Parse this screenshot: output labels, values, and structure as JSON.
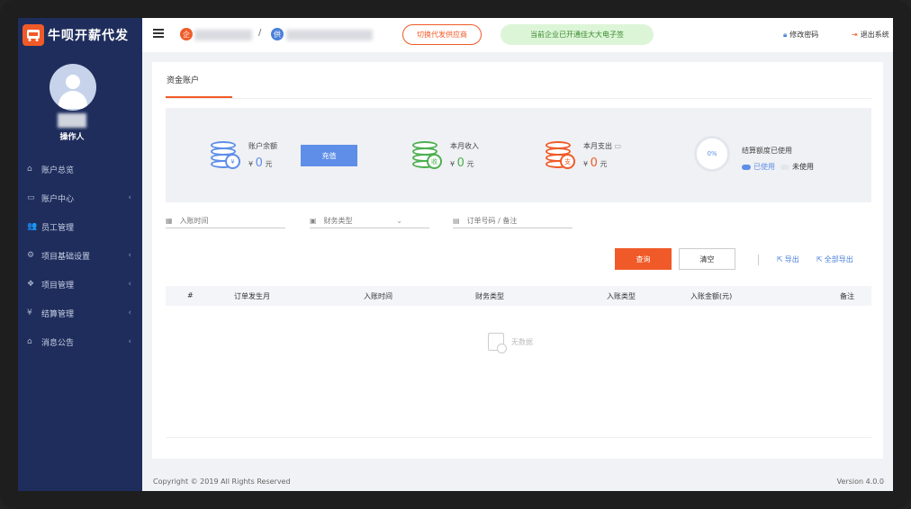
{
  "app": {
    "title": "牛呗开薪代发"
  },
  "sidebar": {
    "role": "操作人",
    "items": [
      {
        "label": "账户总览",
        "icon": "home-icon",
        "has_sub": false
      },
      {
        "label": "账户中心",
        "icon": "card-icon",
        "has_sub": true
      },
      {
        "label": "员工管理",
        "icon": "users-icon",
        "has_sub": false
      },
      {
        "label": "项目基础设置",
        "icon": "gear-icon",
        "has_sub": true
      },
      {
        "label": "项目管理",
        "icon": "cubes-icon",
        "has_sub": true
      },
      {
        "label": "结算管理",
        "icon": "yen-icon",
        "has_sub": true
      },
      {
        "label": "消息公告",
        "icon": "house-icon",
        "has_sub": true
      }
    ]
  },
  "topbar": {
    "switch_label": "切换代发供应商",
    "notice": "当前企业已开通佳大大电子签",
    "change_password": "修改密码",
    "logout": "退出系统",
    "breadcrumb_sep": "/"
  },
  "page": {
    "tab": "资金账户",
    "stats": {
      "balance_label": "账户余额",
      "balance_value": "0",
      "currency_prefix": "¥",
      "unit": "元",
      "recharge": "充值",
      "income_label": "本月收入",
      "income_value": "0",
      "expense_label": "本月支出",
      "expense_value": "0",
      "quota_label": "结算额度已使用",
      "quota_percent": "0%",
      "used": "已使用",
      "unused": "未使用"
    },
    "filters": {
      "date_placeholder": "入账时间",
      "type_placeholder": "财务类型",
      "order_placeholder": "订单号码 / 备注"
    },
    "buttons": {
      "query": "查询",
      "clear": "清空",
      "export": "导出",
      "export_all": "全部导出"
    },
    "table": {
      "columns": [
        "#",
        "订单发生月",
        "入账时间",
        "财务类型",
        "入账类型",
        "入账金额(元)",
        "备注"
      ],
      "empty": "无数据"
    }
  },
  "footer": {
    "copyright": "Copyright © 2019 All Rights Reserved",
    "version": "Version 4.0.0"
  },
  "colors": {
    "sidebar": "#1f2d5c",
    "accent": "#f05a28",
    "primary": "#5e8ee8",
    "income": "#4caf50"
  }
}
